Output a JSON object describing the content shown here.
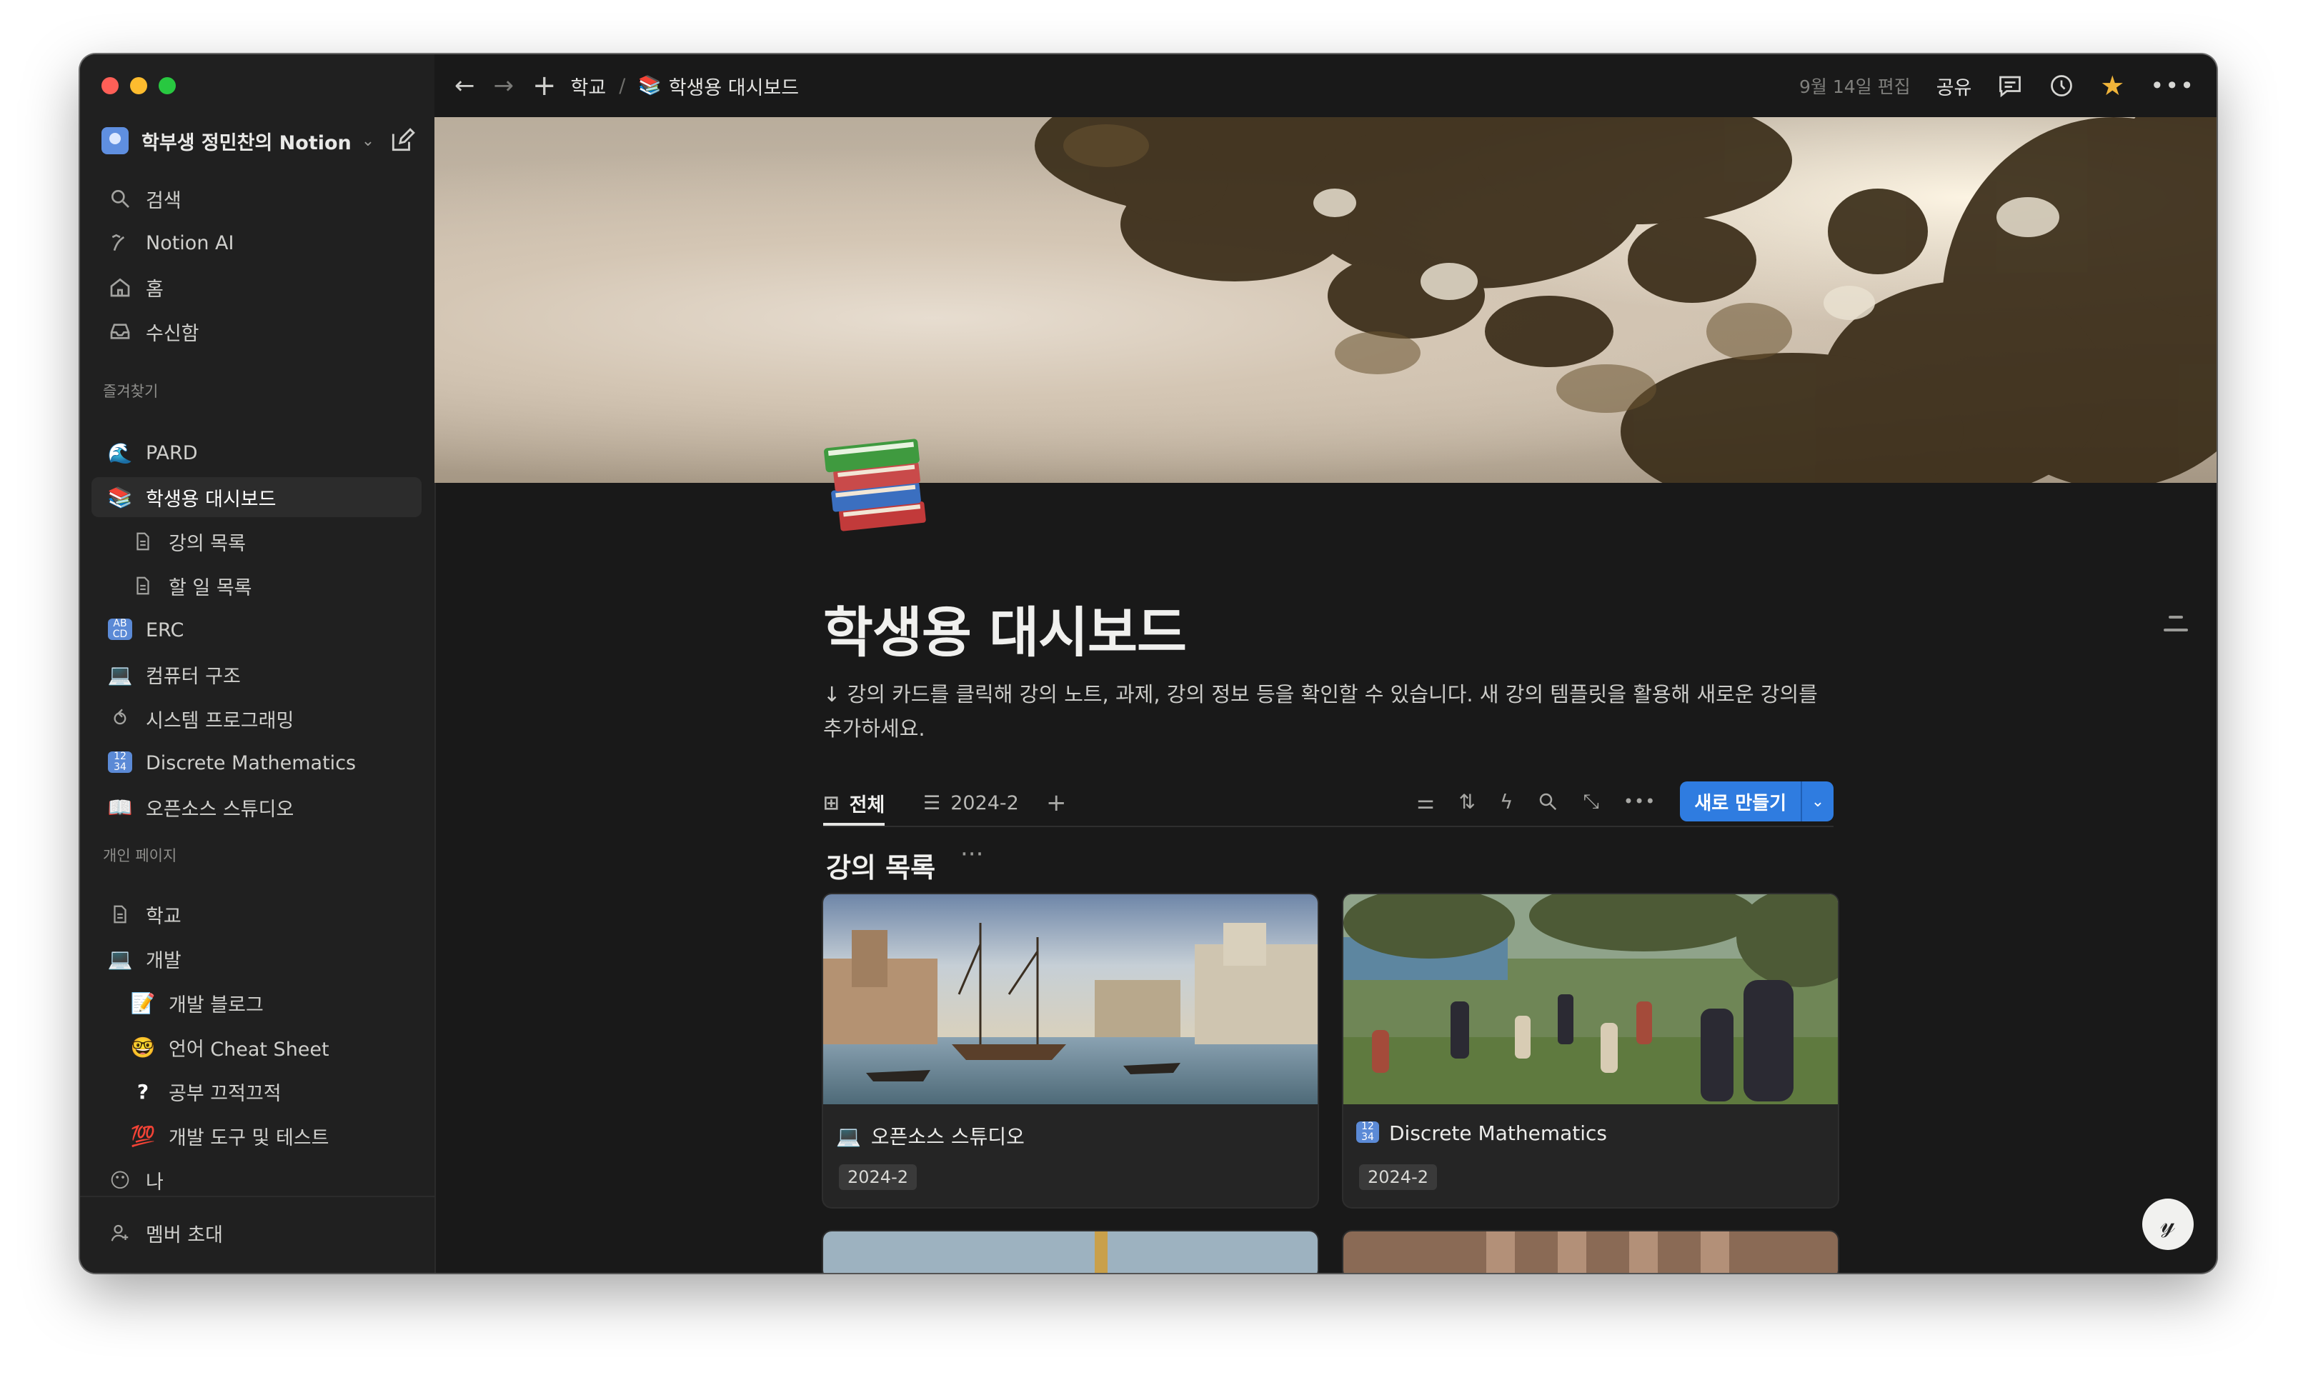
{
  "workspace": {
    "name": "학부생 정민찬의 Notion"
  },
  "sidebar": {
    "top_items": [
      {
        "label": "검색",
        "icon": "search-icon"
      },
      {
        "label": "Notion AI",
        "icon": "notion-ai-icon"
      },
      {
        "label": "홈",
        "icon": "home-icon"
      },
      {
        "label": "수신함",
        "icon": "inbox-icon"
      }
    ],
    "favorites_label": "즐겨찾기",
    "favorites": [
      {
        "label": "PARD",
        "icon": "wave-emoji-icon"
      },
      {
        "label": "학생용 대시보드",
        "icon": "books-emoji-icon",
        "active": true
      },
      {
        "label": "강의 목록",
        "icon": "page-icon"
      },
      {
        "label": "할 일 목록",
        "icon": "page-icon"
      },
      {
        "label": "ERC",
        "icon": "abcd-emoji-icon"
      },
      {
        "label": "컴퓨터 구조",
        "icon": "laptop-emoji-icon"
      },
      {
        "label": "시스템 프로그래밍",
        "icon": "loop-icon"
      },
      {
        "label": "Discrete Mathematics",
        "icon": "numbers-emoji-icon"
      },
      {
        "label": "오픈소스 스튜디오",
        "icon": "book-open-icon"
      }
    ],
    "private_label": "개인 페이지",
    "private": [
      {
        "label": "학교",
        "icon": "page-icon"
      },
      {
        "label": "개발",
        "icon": "laptop-emoji-icon"
      },
      {
        "label": "개발 블로그",
        "icon": "memo-emoji-icon"
      },
      {
        "label": "언어 Cheat Sheet",
        "icon": "nerd-face-emoji-icon"
      },
      {
        "label": "공부 끄적끄적",
        "icon": "question-mark-icon"
      },
      {
        "label": "개발 도구 및 테스트",
        "icon": "hundred-emoji-icon"
      },
      {
        "label": "나",
        "icon": "face-emoji-icon"
      }
    ],
    "invite_label": "멤버 초대"
  },
  "topbar": {
    "breadcrumb": [
      "학교",
      "학생용 대시보드"
    ],
    "breadcrumb_sep": "/",
    "edited": "9월 14일 편집",
    "share": "공유"
  },
  "page": {
    "title": "학생용 대시보드",
    "description": "↓ 강의 카드를 클릭해 강의 노트, 과제, 강의 정보 등을 확인할 수 있습니다. 새 강의 템플릿을 활용해 새로운 강의를 추가하세요.",
    "tabs": [
      {
        "label": "전체",
        "icon": "gallery-icon",
        "active": true
      },
      {
        "label": "2024-2",
        "icon": "list-icon"
      }
    ],
    "new_button": "새로 만들기",
    "group_title": "강의 목록",
    "cards": [
      {
        "title": "오픈소스 스튜디오",
        "icon": "laptop-emoji-icon",
        "tag": "2024-2"
      },
      {
        "title": "Discrete Mathematics",
        "icon": "numbers-emoji-icon",
        "tag": "2024-2"
      }
    ]
  },
  "colors": {
    "background": "#191919",
    "sidebar": "#202020",
    "accent": "#2f7ce0",
    "text": "#e6e6e4"
  }
}
